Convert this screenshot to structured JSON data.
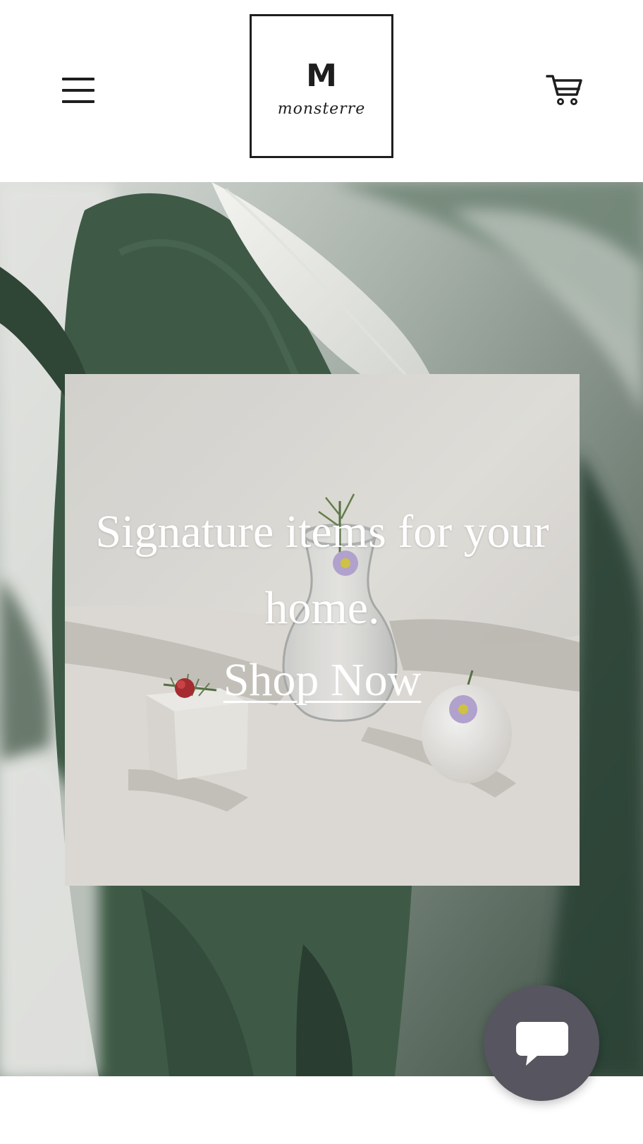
{
  "header": {
    "menu_icon": "hamburger-menu-icon",
    "logo": {
      "letter": "M",
      "wordmark": "monsterre"
    },
    "cart_icon": "shopping-cart-icon"
  },
  "hero": {
    "title": "Signature items for your home.",
    "cta_label": "Shop Now"
  },
  "chat": {
    "icon": "chat-bubble-icon"
  },
  "colors": {
    "text_dark": "#1e1e1e",
    "chat_button": "#57555f",
    "leaf_green": "#3e5a46",
    "card_white": "#e6e3df"
  }
}
